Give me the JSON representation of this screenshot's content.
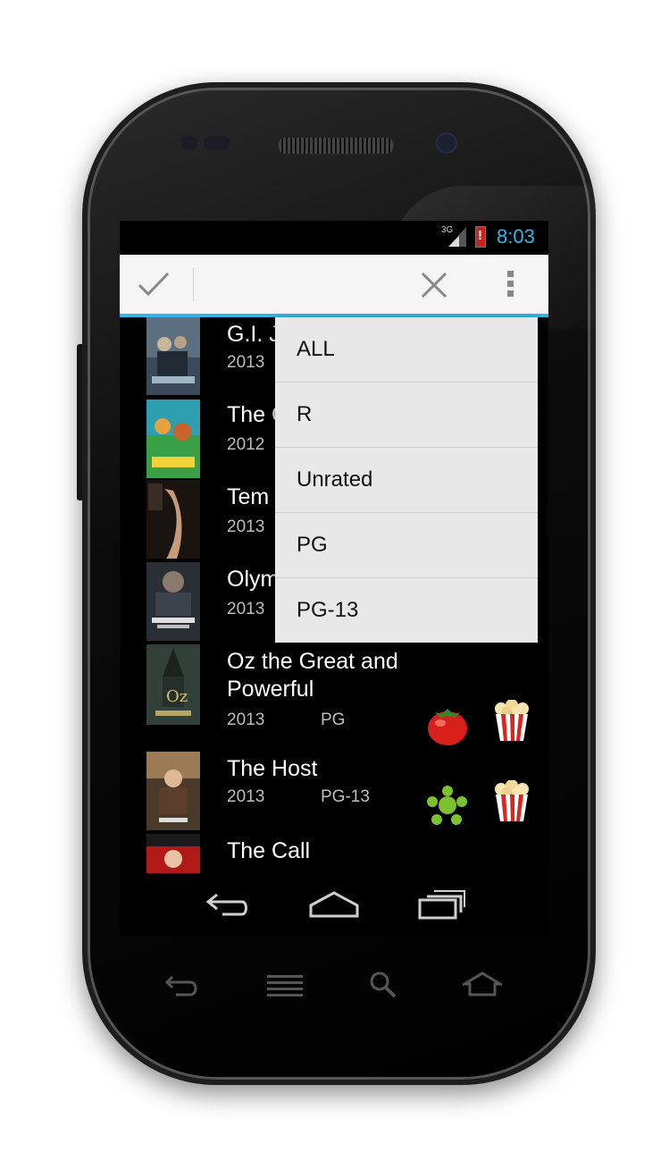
{
  "status_bar": {
    "network": "3G",
    "time": "8:03"
  },
  "action_bar": {
    "done_icon": "check-icon",
    "close_icon": "close-icon",
    "overflow_icon": "overflow-menu-icon"
  },
  "filter_menu": {
    "options": [
      "ALL",
      "R",
      "Unrated",
      "PG",
      "PG-13"
    ]
  },
  "movies": [
    {
      "title": "G.I. J",
      "year": "2013",
      "rating": ""
    },
    {
      "title": "The C",
      "year": "2012",
      "rating": ""
    },
    {
      "title": "Tem",
      "year": "2013",
      "rating": ""
    },
    {
      "title": "Olym",
      "year": "2013",
      "rating": ""
    },
    {
      "title": "Oz the Great and Powerful",
      "year": "2013",
      "rating": "PG",
      "critic_icon": "tomato-icon",
      "audience_icon": "popcorn-icon"
    },
    {
      "title": "The Host",
      "year": "2013",
      "rating": "PG-13",
      "critic_icon": "splat-icon",
      "audience_icon": "popcorn-icon"
    },
    {
      "title": "The Call",
      "year": "",
      "rating": ""
    }
  ],
  "colors": {
    "accent": "#33b5e5",
    "tomato": "#d81f1a",
    "splat": "#7cc22e",
    "popcorn_stripe": "#d8261e"
  }
}
